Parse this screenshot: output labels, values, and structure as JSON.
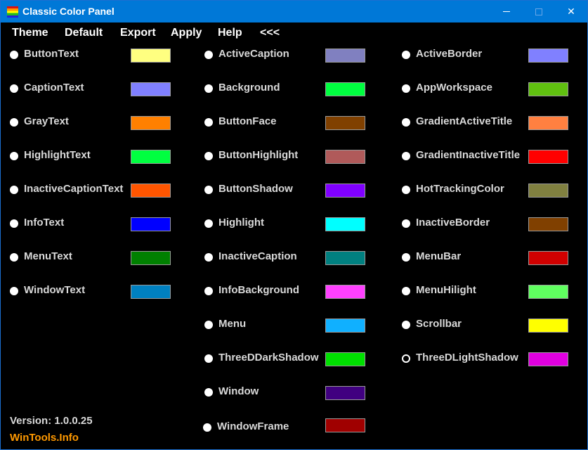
{
  "window": {
    "title": "Classic Color Panel",
    "minimize_symbol": "",
    "maximize_symbol": "",
    "close_symbol": "✕"
  },
  "menu": [
    "Theme",
    "Default",
    "Export",
    "Apply",
    "Help",
    "<<<"
  ],
  "columns": [
    [
      {
        "name": "ButtonText",
        "color": "#ffff80"
      },
      {
        "name": "CaptionText",
        "color": "#8080ff"
      },
      {
        "name": "GrayText",
        "color": "#ff8000"
      },
      {
        "name": "HighlightText",
        "color": "#00ff40"
      },
      {
        "name": "InactiveCaptionText",
        "color": "#ff5500"
      },
      {
        "name": "InfoText",
        "color": "#0000ff"
      },
      {
        "name": "MenuText",
        "color": "#008000"
      },
      {
        "name": "WindowText",
        "color": "#0080c0"
      }
    ],
    [
      {
        "name": "ActiveCaption",
        "color": "#8080c0"
      },
      {
        "name": "Background",
        "color": "#00ff40"
      },
      {
        "name": "ButtonFace",
        "color": "#804000"
      },
      {
        "name": "ButtonHighlight",
        "color": "#b05a5a"
      },
      {
        "name": "ButtonShadow",
        "color": "#8000ff"
      },
      {
        "name": "Highlight",
        "color": "#00ffff"
      },
      {
        "name": "InactiveCaption",
        "color": "#008080"
      },
      {
        "name": "InfoBackground",
        "color": "#ff40ff"
      },
      {
        "name": "Menu",
        "color": "#10b0ff"
      },
      {
        "name": "ThreeDDarkShadow",
        "color": "#00e000"
      },
      {
        "name": "Window",
        "color": "#400080"
      },
      {
        "name": "WindowFrame",
        "color": "#a00000"
      }
    ],
    [
      {
        "name": "ActiveBorder",
        "color": "#8080ff"
      },
      {
        "name": "AppWorkspace",
        "color": "#60c010"
      },
      {
        "name": "GradientActiveTitle",
        "color": "#ff8040"
      },
      {
        "name": "GradientInactiveTitle",
        "color": "#ff0000"
      },
      {
        "name": "HotTrackingColor",
        "color": "#808040"
      },
      {
        "name": "InactiveBorder",
        "color": "#804000"
      },
      {
        "name": "MenuBar",
        "color": "#d00000"
      },
      {
        "name": "MenuHilight",
        "color": "#60ff60"
      },
      {
        "name": "Scrollbar",
        "color": "#ffff00"
      },
      {
        "name": "ThreeDLightShadow",
        "color": "#e000e0",
        "selected": true
      }
    ]
  ],
  "footer": {
    "version": "Version: 1.0.0.25",
    "site": "WinTools.Info"
  }
}
